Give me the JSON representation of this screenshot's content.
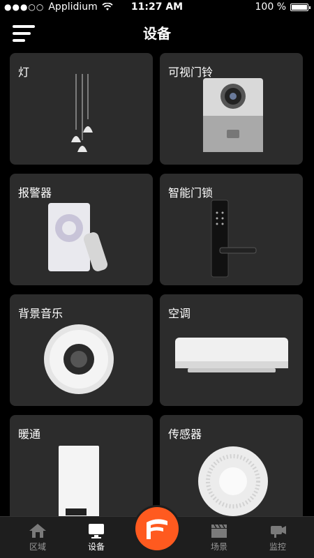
{
  "status_bar": {
    "carrier": "Applidium",
    "time": "11:27 AM",
    "battery": "100 %"
  },
  "header": {
    "title": "设备"
  },
  "devices": [
    {
      "label": "灯",
      "icon": "pendant-lamp-icon"
    },
    {
      "label": "可视门铃",
      "icon": "video-doorbell-icon"
    },
    {
      "label": "报警器",
      "icon": "alarm-device-icon"
    },
    {
      "label": "智能门锁",
      "icon": "smart-lock-icon"
    },
    {
      "label": "背景音乐",
      "icon": "music-controller-icon"
    },
    {
      "label": "空调",
      "icon": "air-conditioner-icon"
    },
    {
      "label": "暖通",
      "icon": "hvac-boiler-icon"
    },
    {
      "label": "传感器",
      "icon": "sensor-icon"
    }
  ],
  "tab_bar": {
    "tabs": [
      {
        "label": "区域",
        "icon": "house-icon"
      },
      {
        "label": "设备",
        "icon": "monitor-icon"
      },
      {
        "label": "场景",
        "icon": "clapperboard-icon"
      },
      {
        "label": "监控",
        "icon": "camera-icon"
      }
    ],
    "active_tab": "设备",
    "colors": {
      "accent": "#ff5a1f",
      "card": "#2c2c2c"
    }
  }
}
